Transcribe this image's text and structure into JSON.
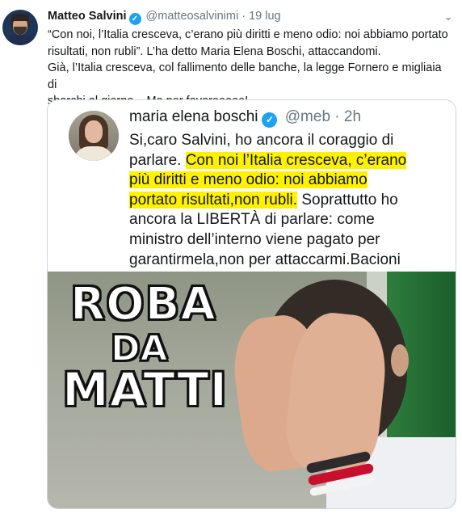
{
  "tweet": {
    "author_name": "Matteo Salvini",
    "handle": "@matteosalvinimi",
    "separator": "·",
    "date": "19 lug",
    "text_lines": [
      "“Con noi, l’Italia cresceva, c’erano più diritti e meno odio: noi abbiamo portato",
      "risultati, non rubli”. L’ha detto Maria Elena Boschi, attaccandomi.",
      "Già, l’Italia cresceva, col fallimento delle banche, la legge Fornero e migliaia di",
      "sbarchi al giorno... Ma per favoreeeee!"
    ]
  },
  "quote": {
    "author_name": "maria elena boschi",
    "handle": "@meb",
    "separator": "·",
    "time": "2h",
    "line1": "Si,caro Salvini, ho ancora il coraggio di",
    "line2_plain": "parlare. ",
    "line2_hl": "Con noi l’Italia cresceva, c’erano",
    "line3_hl": "più diritti e meno odio: noi abbiamo",
    "line4_hl": "portato risultati,non rubli.",
    "line4_plain": " Soprattutto ho",
    "line5": "ancora la LIBERTÀ di parlare: come",
    "line6": "ministro dell’interno viene pagato per",
    "line7": "garantirmela,non per attaccarmi.Bacioni",
    "image_text": [
      "ROBA",
      "DA",
      "MATTI"
    ]
  },
  "icons": {
    "verified": "verified-badge-icon",
    "menu": "chevron-down-icon"
  },
  "colors": {
    "verified": "#1da1f2",
    "highlight": "#fff200",
    "muted": "#657786"
  }
}
